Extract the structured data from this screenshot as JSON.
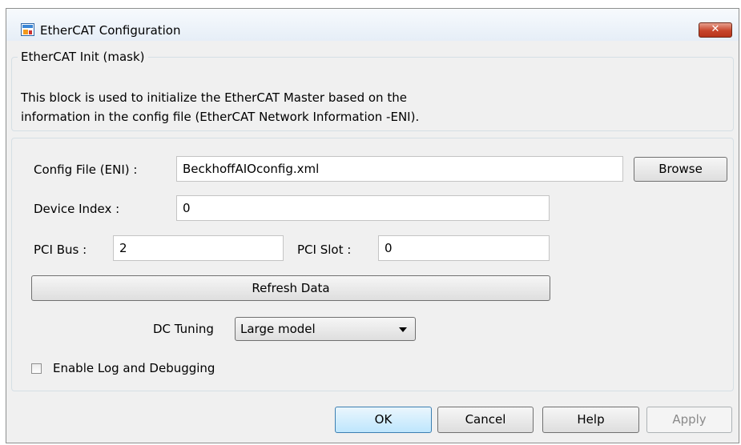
{
  "window": {
    "title": "EtherCAT Configuration",
    "close_label": "✕"
  },
  "mask_group": {
    "legend": "EtherCAT Init (mask)",
    "description_line1": "This block is used to initialize the EtherCAT Master based on the",
    "description_line2": "information in the config file (EtherCAT Network Information -ENI)."
  },
  "params": {
    "config_file_label": "Config File (ENI) :",
    "config_file_value": "BeckhoffAIOconfig.xml",
    "browse_label": "Browse",
    "device_index_label": "Device Index :",
    "device_index_value": "0",
    "pci_bus_label": "PCI Bus :",
    "pci_bus_value": "2",
    "pci_slot_label": "PCI Slot :",
    "pci_slot_value": "0",
    "refresh_label": "Refresh Data",
    "dc_tuning_label": "DC Tuning",
    "dc_tuning_value": "Large model",
    "enable_log_label": "Enable Log and Debugging",
    "enable_log_checked": false
  },
  "footer": {
    "ok_label": "OK",
    "cancel_label": "Cancel",
    "help_label": "Help",
    "apply_label": "Apply"
  }
}
